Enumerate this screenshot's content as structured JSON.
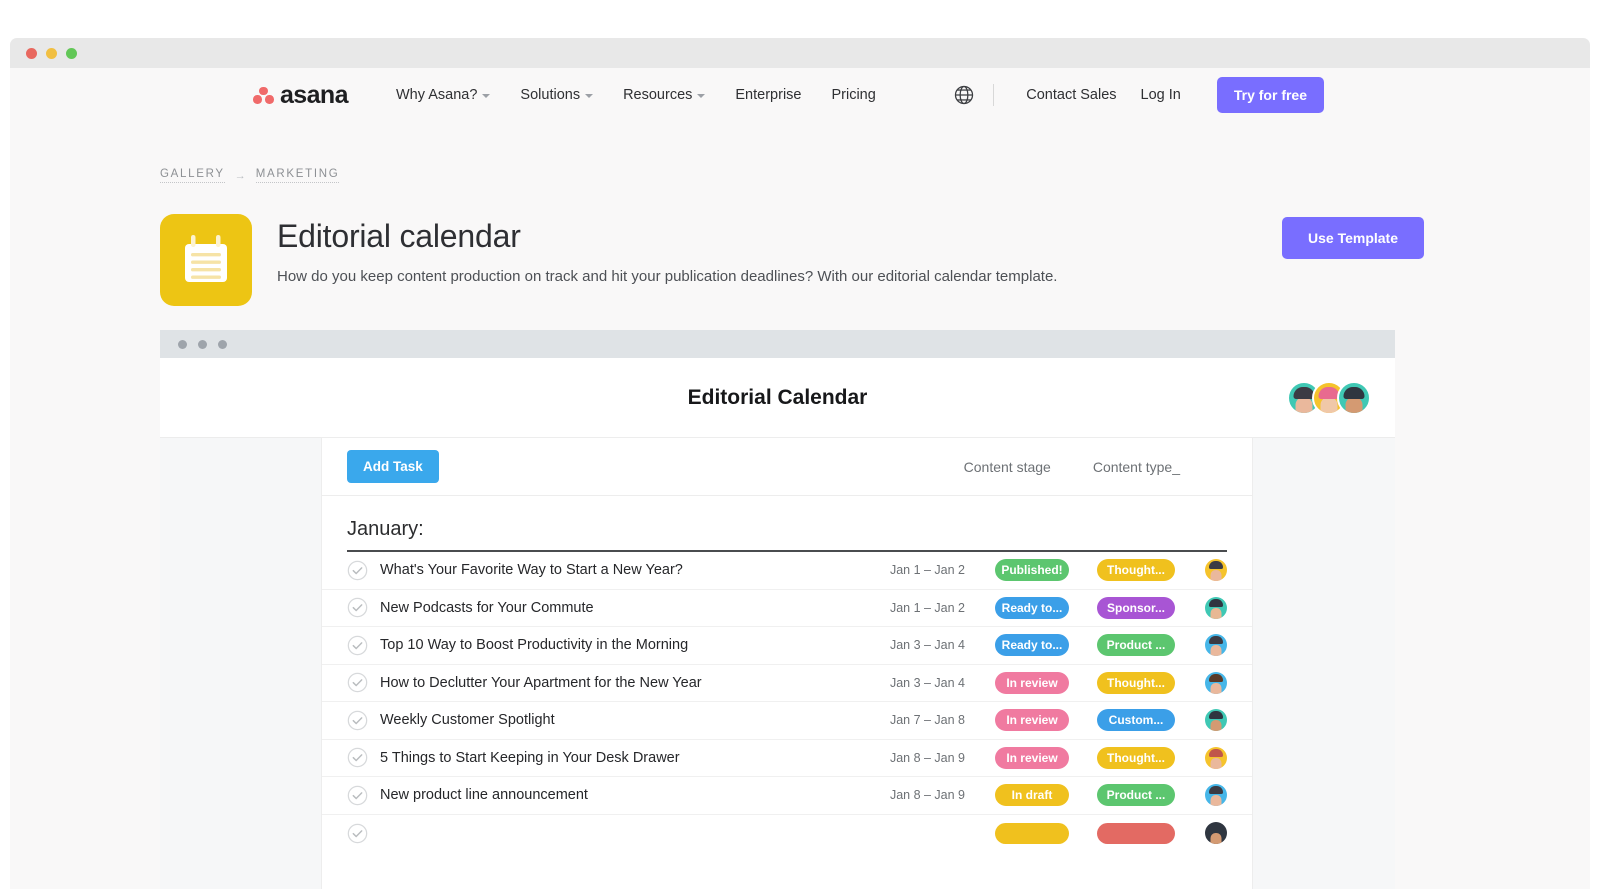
{
  "window": {
    "traffic_lights": [
      "close",
      "minimize",
      "maximize"
    ]
  },
  "nav": {
    "logo_text": "asana",
    "logo_icon": "asana-logo-icon",
    "links": [
      {
        "label": "Why Asana?",
        "has_caret": true
      },
      {
        "label": "Solutions",
        "has_caret": true
      },
      {
        "label": "Resources",
        "has_caret": true
      },
      {
        "label": "Enterprise",
        "has_caret": false
      },
      {
        "label": "Pricing",
        "has_caret": false
      }
    ],
    "globe_icon": "globe-icon",
    "contact_sales": "Contact Sales",
    "log_in": "Log In",
    "try_free": "Try for free"
  },
  "breadcrumb": {
    "gallery": "GALLERY",
    "arrow": "→",
    "marketing": "MARKETING"
  },
  "template": {
    "icon": "notepad-icon",
    "icon_color": "#edc514",
    "title": "Editorial calendar",
    "description": "How do you keep content production on track and hit your publication deadlines? With our editorial calendar template.",
    "use_template_label": "Use Template",
    "accent_color": "#796eff"
  },
  "app": {
    "title": "Editorial Calendar",
    "window_dots": [
      "dot",
      "dot",
      "dot"
    ],
    "collaborators": [
      {
        "name": "avatar-1",
        "bg": "#3fc8b4",
        "hair": "#3b3b44",
        "skin": "#eab89c"
      },
      {
        "name": "avatar-2",
        "bg": "#f5c32c",
        "hair": "#e86a8f",
        "skin": "#f0c8a8"
      },
      {
        "name": "avatar-3",
        "bg": "#3fc8b4",
        "hair": "#2f3640",
        "skin": "#d49a72"
      }
    ],
    "toolbar": {
      "add_task_label": "Add Task",
      "add_task_color": "#3aa8ec",
      "columns": [
        "Content stage",
        "Content type_"
      ]
    },
    "section_label": "January:",
    "tasks": [
      {
        "title": "What's Your Favorite Way to Start a New Year?",
        "date": "Jan 1 – Jan 2",
        "stage": "Published!",
        "stage_color": "#5cc66f",
        "type": "Thought...",
        "type_color": "#f0c11e",
        "avatar_bg": "#f5c32c",
        "avatar_hair": "#3b3b44",
        "avatar_skin": "#eab89c"
      },
      {
        "title": "New Podcasts for Your Commute",
        "date": "Jan 1 – Jan 2",
        "stage": "Ready to...",
        "stage_color": "#3b9fe8",
        "type": "Sponsor...",
        "type_color": "#a855d4",
        "avatar_bg": "#3fc8b4",
        "avatar_hair": "#2f3640",
        "avatar_skin": "#e8b894"
      },
      {
        "title": "Top 10 Way to Boost Productivity in the Morning",
        "date": "Jan 3 – Jan 4",
        "stage": "Ready to...",
        "stage_color": "#3b9fe8",
        "type": "Product ...",
        "type_color": "#5cc66f",
        "avatar_bg": "#46b6e8",
        "avatar_hair": "#3b3b44",
        "avatar_skin": "#eab89c"
      },
      {
        "title": "How to Declutter Your Apartment for the New Year",
        "date": "Jan 3 – Jan 4",
        "stage": "In review",
        "stage_color": "#f07aa0",
        "type": "Thought...",
        "type_color": "#f0c11e",
        "avatar_bg": "#46b6e8",
        "avatar_hair": "#5a3a28",
        "avatar_skin": "#eab89c"
      },
      {
        "title": "Weekly Customer Spotlight",
        "date": "Jan 7 – Jan 8",
        "stage": "In review",
        "stage_color": "#f07aa0",
        "type": "Custom...",
        "type_color": "#3b9fe8",
        "avatar_bg": "#3fc8b4",
        "avatar_hair": "#2f3640",
        "avatar_skin": "#d49a72"
      },
      {
        "title": "5 Things to Start Keeping in Your Desk Drawer",
        "date": "Jan 8 – Jan 9",
        "stage": "In review",
        "stage_color": "#f07aa0",
        "type": "Thought...",
        "type_color": "#f0c11e",
        "avatar_bg": "#f5c32c",
        "avatar_hair": "#c0564a",
        "avatar_skin": "#eab89c"
      },
      {
        "title": "New product line announcement",
        "date": "Jan 8 – Jan 9",
        "stage": "In draft",
        "stage_color": "#f0c11e",
        "type": "Product ...",
        "type_color": "#5cc66f",
        "avatar_bg": "#46b6e8",
        "avatar_hair": "#3b3b44",
        "avatar_skin": "#eab89c"
      },
      {
        "title": "",
        "date": "",
        "stage": "",
        "stage_color": "#f0c11e",
        "type": "",
        "type_color": "#e36a63",
        "avatar_bg": "#2f3640",
        "avatar_hair": "#2f3640",
        "avatar_skin": "#d49a72"
      }
    ]
  }
}
